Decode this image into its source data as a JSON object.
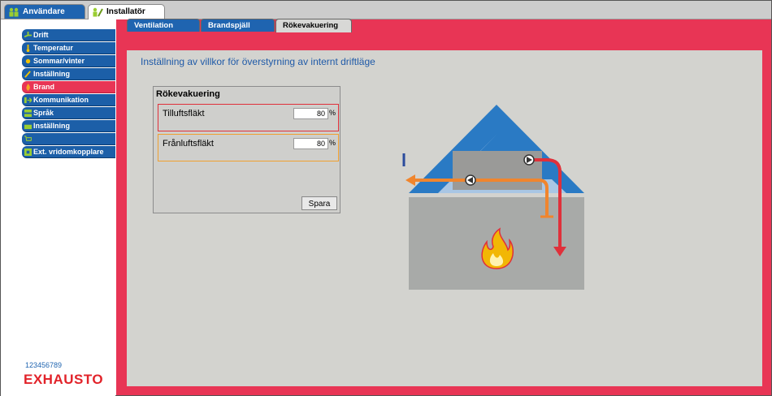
{
  "top_tabs": [
    {
      "label": "Användare",
      "icon": "users-icon"
    },
    {
      "label": "Installatör",
      "icon": "installer-icon"
    }
  ],
  "sidebar": {
    "items": [
      {
        "label": "Drift",
        "icon": "fan-icon",
        "state": "normal"
      },
      {
        "label": "Temperatur",
        "icon": "thermometer-icon",
        "state": "normal"
      },
      {
        "label": "Sommar/vinter",
        "icon": "sun-icon",
        "state": "normal"
      },
      {
        "label": "Inställning",
        "icon": "pencil-icon",
        "state": "normal"
      },
      {
        "label": "Brand",
        "icon": "flame-icon",
        "state": "active"
      },
      {
        "label": "Kommunikation",
        "icon": "arrow-icon",
        "state": "normal"
      },
      {
        "label": "Språk",
        "icon": "flags-icon",
        "state": "normal"
      },
      {
        "label": "Inställning",
        "icon": "display-icon",
        "state": "normal"
      },
      {
        "label": "",
        "icon": "cart-icon",
        "state": "disabled"
      },
      {
        "label": "Ext. vridomkopplare",
        "icon": "switch-icon",
        "state": "normal"
      }
    ],
    "serial": "123456789",
    "logo": "EXHAUSTO"
  },
  "main": {
    "tabs": [
      {
        "label": "Ventilation"
      },
      {
        "label": "Brandspjäll"
      },
      {
        "label": "Rökevakuering"
      }
    ],
    "active_tab": "Rökevakuering",
    "heading": "Inställning av villkor för överstyrning av internt driftläge",
    "card": {
      "title": "Rökevakuering",
      "fields": [
        {
          "label": "Tilluftsfläkt",
          "value": "80",
          "unit": "%",
          "border_color": "#e0303a"
        },
        {
          "label": "Frånluftsfläkt",
          "value": "80",
          "unit": "%",
          "border_color": "#f0a030"
        }
      ],
      "save_label": "Spara"
    }
  },
  "colors": {
    "accent_red": "#e83555",
    "nav_blue": "#1c5fa8",
    "panel_gray": "#d3d3cf",
    "heading_blue": "#1f5aa8",
    "logo_red": "#e2232a"
  }
}
